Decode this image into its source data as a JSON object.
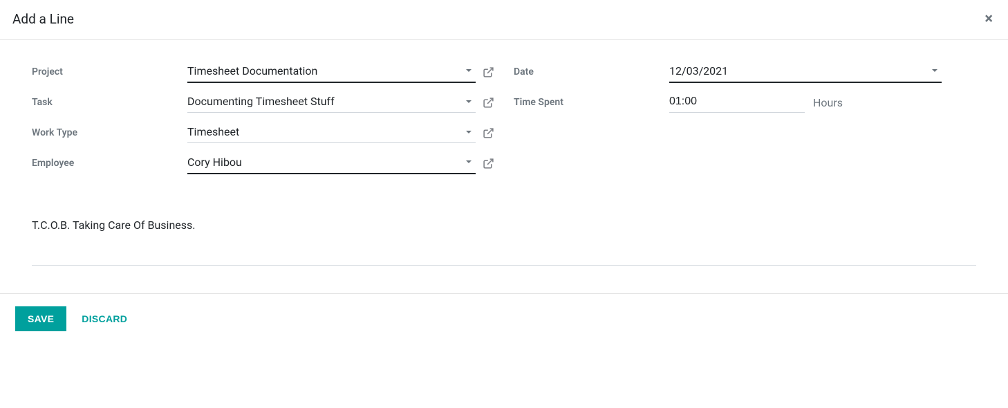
{
  "modal": {
    "title": "Add a Line"
  },
  "labels": {
    "project": "Project",
    "task": "Task",
    "work_type": "Work Type",
    "employee": "Employee",
    "date": "Date",
    "time_spent": "Time Spent",
    "hours_unit": "Hours"
  },
  "fields": {
    "project": "Timesheet Documentation",
    "task": "Documenting Timesheet Stuff",
    "work_type": "Timesheet",
    "employee": "Cory Hibou",
    "date": "12/03/2021",
    "time_spent": "01:00",
    "description": "T.C.O.B. Taking Care Of Business."
  },
  "buttons": {
    "save": "Save",
    "discard": "Discard"
  }
}
